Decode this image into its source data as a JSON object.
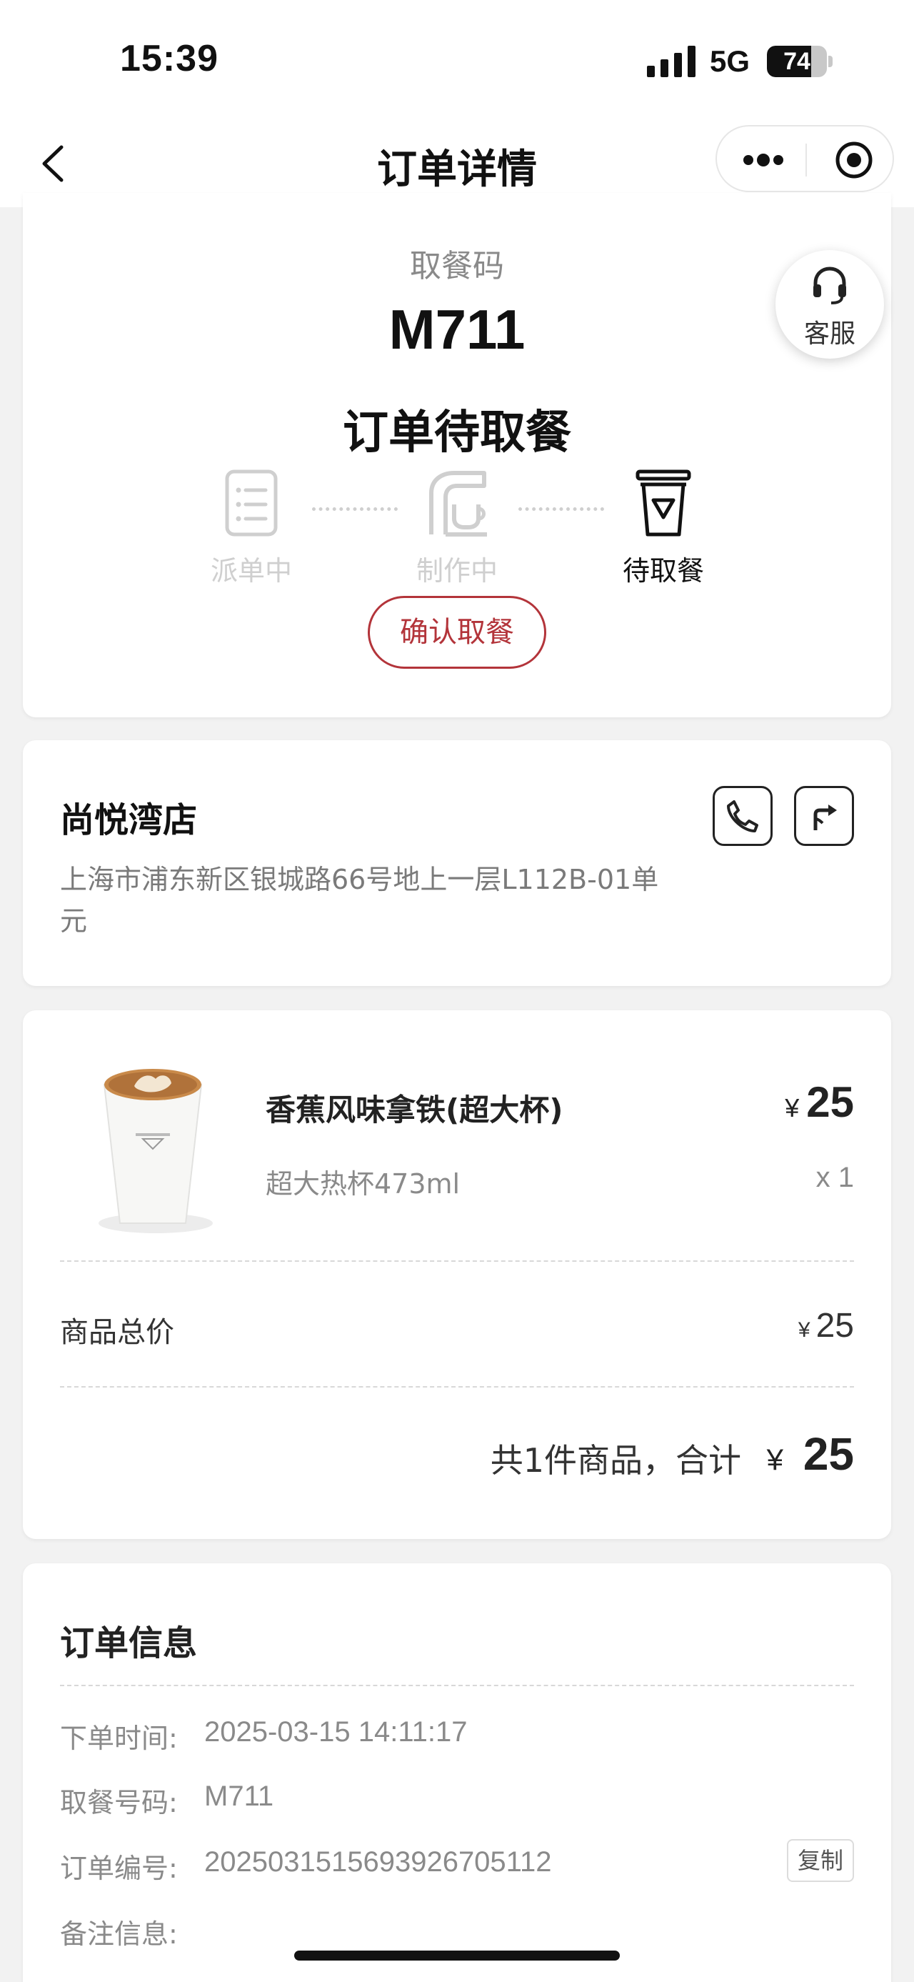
{
  "status_bar": {
    "time": "15:39",
    "network": "5G",
    "battery": "74",
    "battery_level": 0.74
  },
  "nav": {
    "title": "订单详情"
  },
  "pickup": {
    "label": "取餐码",
    "code": "M711",
    "status": "订单待取餐",
    "steps": [
      {
        "label": "派单中",
        "icon": "list-icon",
        "active": false
      },
      {
        "label": "制作中",
        "icon": "coffee-machine-icon",
        "active": false
      },
      {
        "label": "待取餐",
        "icon": "cup-icon",
        "active": true
      }
    ],
    "confirm_label": "确认取餐"
  },
  "service": {
    "label": "客服",
    "icon": "headset-icon"
  },
  "store": {
    "name": "尚悦湾店",
    "address": "上海市浦东新区银城路66号地上一层L112B-01单元"
  },
  "product": {
    "name": "香蕉风味拿铁(超大杯)",
    "spec": "超大热杯473ml",
    "currency": "¥",
    "price": "25",
    "qty": "x 1",
    "subtotal_label": "商品总价",
    "subtotal": "25",
    "total_text": "共1件商品，合计",
    "total": "25"
  },
  "order_info": {
    "title": "订单信息",
    "rows": [
      {
        "label": "下单时间:",
        "value": "2025-03-15 14:11:17"
      },
      {
        "label": "取餐号码:",
        "value": "M711"
      },
      {
        "label": "订单编号:",
        "value": "2025031515693926705112"
      },
      {
        "label": "备注信息:",
        "value": ""
      }
    ],
    "copy_label": "复制"
  },
  "colors": {
    "accent": "#b3343a",
    "inactive": "#cfcfcf",
    "background": "#f2f2f2"
  }
}
